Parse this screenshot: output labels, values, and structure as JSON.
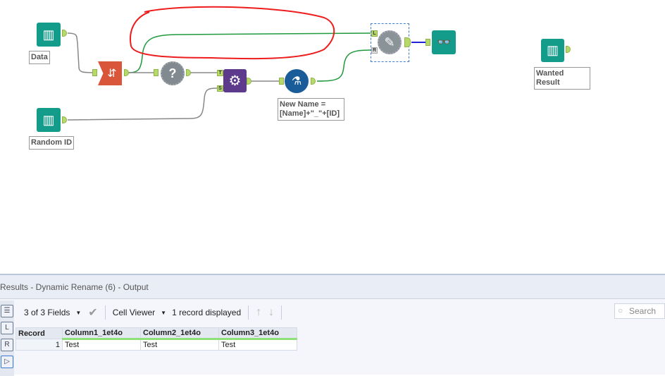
{
  "canvas": {
    "tools": {
      "data_input": {
        "label": "Data"
      },
      "random_id_input": {
        "label": "Random ID"
      },
      "formula": {
        "label": "New Name =\n[Name]+\"_\"+[ID]"
      },
      "wanted_input": {
        "label": "Wanted Result"
      },
      "append_anchors": {
        "t": "T",
        "s": "S"
      },
      "rename_anchors": {
        "l": "L",
        "r": "R"
      }
    },
    "annotation_color": "#ff0000"
  },
  "results": {
    "title": "Results - Dynamic Rename (6) - Output",
    "sidebar": {
      "l": "L",
      "r": "R"
    },
    "toolbar": {
      "fields": "3 of 3 Fields",
      "viewer": "Cell Viewer",
      "records": "1 record displayed",
      "search_placeholder": "Search"
    },
    "table": {
      "headers": [
        "Record",
        "Column1_1et4o",
        "Column2_1et4o",
        "Column3_1et4o"
      ],
      "rows": [
        [
          "1",
          "Test",
          "Test",
          "Test"
        ]
      ]
    }
  }
}
